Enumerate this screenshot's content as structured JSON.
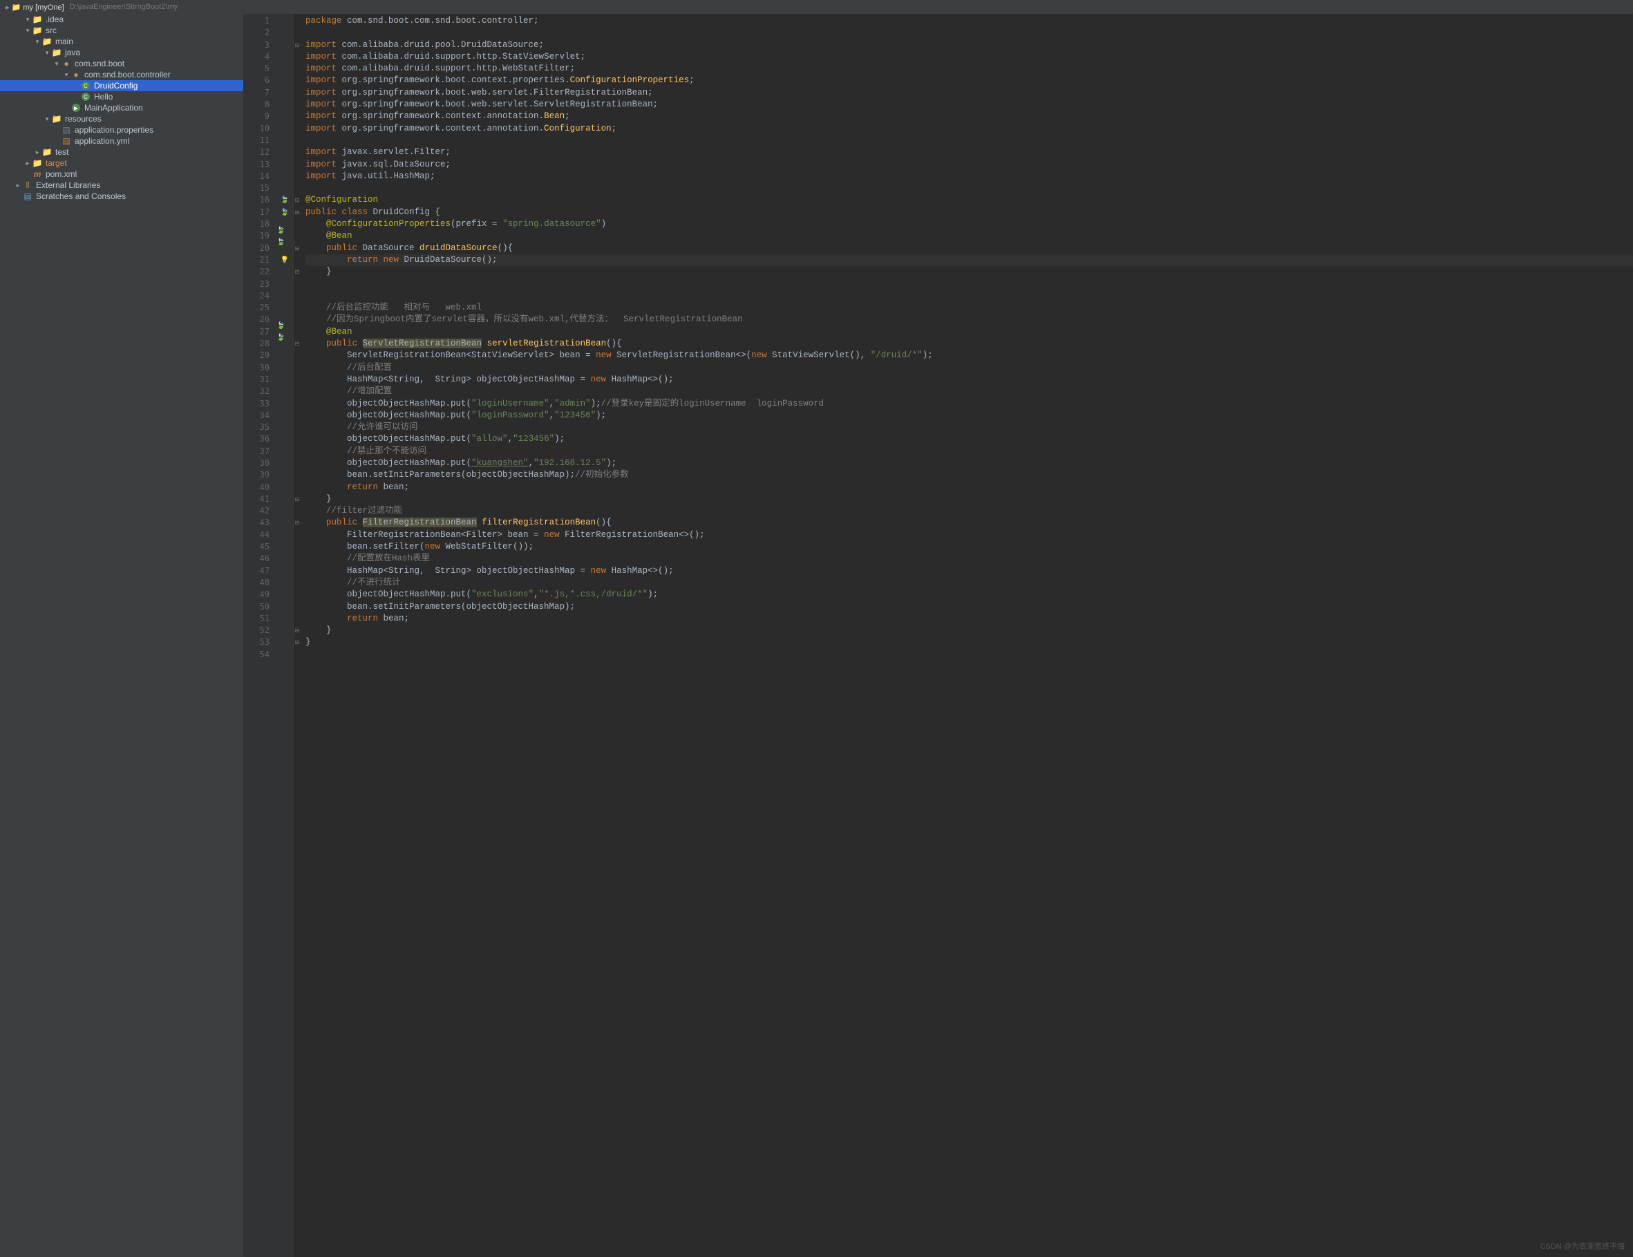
{
  "topbar": {
    "project": "my [myOne]",
    "path": "D:\\javaEngineer\\StirngBoot2\\my"
  },
  "tree": [
    {
      "indent": 0,
      "arrow": "v",
      "icon": "folder",
      "label": ".idea"
    },
    {
      "indent": 0,
      "arrow": "v",
      "icon": "folder-src",
      "label": "src"
    },
    {
      "indent": 1,
      "arrow": "v",
      "icon": "folder-src",
      "label": "main"
    },
    {
      "indent": 2,
      "arrow": "v",
      "icon": "folder-java",
      "label": "java"
    },
    {
      "indent": 3,
      "arrow": "v",
      "icon": "pkg",
      "label": "com.snd.boot"
    },
    {
      "indent": 4,
      "arrow": "v",
      "icon": "pkg",
      "label": "com.snd.boot.controller"
    },
    {
      "indent": 5,
      "arrow": "",
      "icon": "class",
      "label": "DruidConfig",
      "selected": true
    },
    {
      "indent": 5,
      "arrow": "",
      "icon": "class",
      "label": "Hello"
    },
    {
      "indent": 4,
      "arrow": "",
      "icon": "class-run",
      "label": "MainApplication"
    },
    {
      "indent": 2,
      "arrow": "v",
      "icon": "folder-res",
      "label": "resources"
    },
    {
      "indent": 3,
      "arrow": "",
      "icon": "file",
      "label": "application.properties"
    },
    {
      "indent": 3,
      "arrow": "",
      "icon": "yml",
      "label": "application.yml"
    },
    {
      "indent": 1,
      "arrow": ">",
      "icon": "folder-src",
      "label": "test"
    },
    {
      "indent": 0,
      "arrow": ">",
      "icon": "folder",
      "label": "target",
      "hl": true
    },
    {
      "indent": 0,
      "arrow": "",
      "icon": "maven",
      "label": "pom.xml"
    },
    {
      "indent": -1,
      "arrow": ">",
      "icon": "lib",
      "label": "External Libraries"
    },
    {
      "indent": -1,
      "arrow": "",
      "icon": "scratch",
      "label": "Scratches and Consoles"
    }
  ],
  "code": {
    "lines": 54,
    "tokens": {
      "l1": [
        [
          "kw",
          "package "
        ],
        [
          "",
          "com.snd.boot.com.snd.boot.controller;"
        ]
      ],
      "l3": [
        [
          "kw",
          "import "
        ],
        [
          "",
          "com.alibaba.druid.pool.DruidDataSource;"
        ]
      ],
      "l4": [
        [
          "kw",
          "import "
        ],
        [
          "",
          "com.alibaba.druid.support.http.StatViewServlet;"
        ]
      ],
      "l5": [
        [
          "kw",
          "import "
        ],
        [
          "",
          "com.alibaba.druid.support.http.WebStatFilter;"
        ]
      ],
      "l6": [
        [
          "kw",
          "import "
        ],
        [
          "",
          "org.springframework.boot.context.properties."
        ],
        [
          "clsname",
          "ConfigurationProperties"
        ],
        [
          "",
          ";"
        ]
      ],
      "l7": [
        [
          "kw",
          "import "
        ],
        [
          "",
          "org.springframework.boot.web.servlet.FilterRegistrationBean;"
        ]
      ],
      "l8": [
        [
          "kw",
          "import "
        ],
        [
          "",
          "org.springframework.boot.web.servlet.ServletRegistrationBean;"
        ]
      ],
      "l9": [
        [
          "kw",
          "import "
        ],
        [
          "",
          "org.springframework.context.annotation."
        ],
        [
          "clsname",
          "Bean"
        ],
        [
          "",
          ";"
        ]
      ],
      "l10": [
        [
          "kw",
          "import "
        ],
        [
          "",
          "org.springframework.context.annotation."
        ],
        [
          "clsname",
          "Configuration"
        ],
        [
          "",
          ";"
        ]
      ],
      "l12": [
        [
          "kw",
          "import "
        ],
        [
          "",
          "javax.servlet.Filter;"
        ]
      ],
      "l13": [
        [
          "kw",
          "import "
        ],
        [
          "",
          "javax.sql.DataSource;"
        ]
      ],
      "l14": [
        [
          "kw",
          "import "
        ],
        [
          "",
          "java.util.HashMap;"
        ]
      ],
      "l16": [
        [
          "ann",
          "@Configuration"
        ]
      ],
      "l17": [
        [
          "kw",
          "public class "
        ],
        [
          "",
          "DruidConfig {"
        ]
      ],
      "l18": [
        [
          "",
          "    "
        ],
        [
          "ann",
          "@ConfigurationProperties"
        ],
        [
          "",
          "(prefix = "
        ],
        [
          "str",
          "\"spring.datasource\""
        ],
        [
          "",
          ")"
        ]
      ],
      "l19": [
        [
          "",
          "    "
        ],
        [
          "ann",
          "@Bean"
        ]
      ],
      "l20": [
        [
          "",
          "    "
        ],
        [
          "kw",
          "public "
        ],
        [
          "",
          "DataSource "
        ],
        [
          "clsname",
          "druidDataSource"
        ],
        [
          "",
          "(){"
        ]
      ],
      "l21": [
        [
          "",
          "        "
        ],
        [
          "kw",
          "return new "
        ],
        [
          "",
          "DruidDataSource();"
        ]
      ],
      "l22": [
        [
          "",
          "    }"
        ]
      ],
      "l25": [
        [
          "",
          "    "
        ],
        [
          "cmt",
          "//后台监控功能   相对与   web.xml"
        ]
      ],
      "l26": [
        [
          "",
          "    "
        ],
        [
          "cmt",
          "//因为Springboot内置了servlet容器，所以没有web.xml,代替方法：  ServletRegistrationBean"
        ]
      ],
      "l27": [
        [
          "",
          "    "
        ],
        [
          "ann",
          "@Bean"
        ]
      ],
      "l28": [
        [
          "",
          "    "
        ],
        [
          "kw",
          "public "
        ],
        [
          "hl-warn",
          "ServletRegistrationBean"
        ],
        [
          "",
          " "
        ],
        [
          "clsname",
          "servletRegistrationBean"
        ],
        [
          "",
          "(){"
        ]
      ],
      "l29": [
        [
          "",
          "        ServletRegistrationBean<StatViewServlet> bean = "
        ],
        [
          "kw",
          "new "
        ],
        [
          "",
          "ServletRegistrationBean<>("
        ],
        [
          "kw",
          "new "
        ],
        [
          "",
          "StatViewServlet(), "
        ],
        [
          "str",
          "\"/druid/*\""
        ],
        [
          "",
          ");"
        ]
      ],
      "l30": [
        [
          "",
          "        "
        ],
        [
          "cmt",
          "//后台配置"
        ]
      ],
      "l31": [
        [
          "",
          "        HashMap<String,  String> objectObjectHashMap = "
        ],
        [
          "kw",
          "new "
        ],
        [
          "",
          "HashMap<>();"
        ]
      ],
      "l32": [
        [
          "",
          "        "
        ],
        [
          "cmt",
          "//增加配置"
        ]
      ],
      "l33": [
        [
          "",
          "        objectObjectHashMap.put("
        ],
        [
          "str",
          "\"loginUsername\""
        ],
        [
          "",
          ","
        ],
        [
          "str",
          "\"admin\""
        ],
        [
          "",
          ");"
        ],
        [
          "cmt",
          "//登录key是固定的loginUsername  loginPassword"
        ]
      ],
      "l34": [
        [
          "",
          "        objectObjectHashMap.put("
        ],
        [
          "str",
          "\"loginPassword\""
        ],
        [
          "",
          ","
        ],
        [
          "str",
          "\"123456\""
        ],
        [
          "",
          ");"
        ]
      ],
      "l35": [
        [
          "",
          "        "
        ],
        [
          "cmt",
          "//允许谁可以访问"
        ]
      ],
      "l36": [
        [
          "",
          "        objectObjectHashMap.put("
        ],
        [
          "str",
          "\"allow\""
        ],
        [
          "",
          ","
        ],
        [
          "str",
          "\"123456\""
        ],
        [
          "",
          ");"
        ]
      ],
      "l37": [
        [
          "",
          "        "
        ],
        [
          "cmt",
          "//禁止那个不能访问"
        ]
      ],
      "l38": [
        [
          "",
          "        objectObjectHashMap.put("
        ],
        [
          "underline-link",
          "\"kuangshen\""
        ],
        [
          "",
          ","
        ],
        [
          "str",
          "\"192.168.12.5\""
        ],
        [
          "",
          ");"
        ]
      ],
      "l39": [
        [
          "",
          "        bean.setInitParameters(objectObjectHashMap);"
        ],
        [
          "cmt",
          "//初始化参数"
        ]
      ],
      "l40": [
        [
          "",
          "        "
        ],
        [
          "kw",
          "return "
        ],
        [
          "",
          "bean;"
        ]
      ],
      "l41": [
        [
          "",
          "    }"
        ]
      ],
      "l42": [
        [
          "",
          "    "
        ],
        [
          "cmt",
          "//filter过滤功能"
        ]
      ],
      "l43": [
        [
          "",
          "    "
        ],
        [
          "kw",
          "public "
        ],
        [
          "hl-warn",
          "FilterRegistrationBean"
        ],
        [
          "",
          " "
        ],
        [
          "clsname",
          "filterRegistrationBean"
        ],
        [
          "",
          "(){"
        ]
      ],
      "l44": [
        [
          "",
          "        FilterRegistrationBean<Filter> bean = "
        ],
        [
          "kw",
          "new "
        ],
        [
          "",
          "FilterRegistrationBean<>();"
        ]
      ],
      "l45": [
        [
          "",
          "        bean.setFilter("
        ],
        [
          "kw",
          "new "
        ],
        [
          "",
          "WebStatFilter());"
        ]
      ],
      "l46": [
        [
          "",
          "        "
        ],
        [
          "cmt",
          "//配置放在Hash表里"
        ]
      ],
      "l47": [
        [
          "",
          "        HashMap<String,  String> objectObjectHashMap = "
        ],
        [
          "kw",
          "new "
        ],
        [
          "",
          "HashMap<>();"
        ]
      ],
      "l48": [
        [
          "",
          "        "
        ],
        [
          "cmt",
          "//不进行统计"
        ]
      ],
      "l49": [
        [
          "",
          "        objectObjectHashMap.put("
        ],
        [
          "str",
          "\"exclusions\""
        ],
        [
          "",
          ","
        ],
        [
          "str",
          "\"*.js,*.css,/druid/*\""
        ],
        [
          "",
          ");"
        ]
      ],
      "l50": [
        [
          "",
          "        bean.setInitParameters(objectObjectHashMap);"
        ]
      ],
      "l51": [
        [
          "",
          "        "
        ],
        [
          "kw",
          "return "
        ],
        [
          "",
          "bean;"
        ]
      ],
      "l52": [
        [
          "",
          "    }"
        ]
      ],
      "l53": [
        [
          "",
          "}"
        ]
      ]
    },
    "gutter_icons": {
      "16": "bean-leaf",
      "17": "bean-leaf",
      "19": "bean-leaf2",
      "21": "bulb",
      "27": "bean-leaf2"
    },
    "folds": [
      3,
      16,
      17,
      20,
      22,
      28,
      41,
      43,
      52,
      53
    ]
  },
  "watermark": "CSDN @为衣渐宽终不悔"
}
